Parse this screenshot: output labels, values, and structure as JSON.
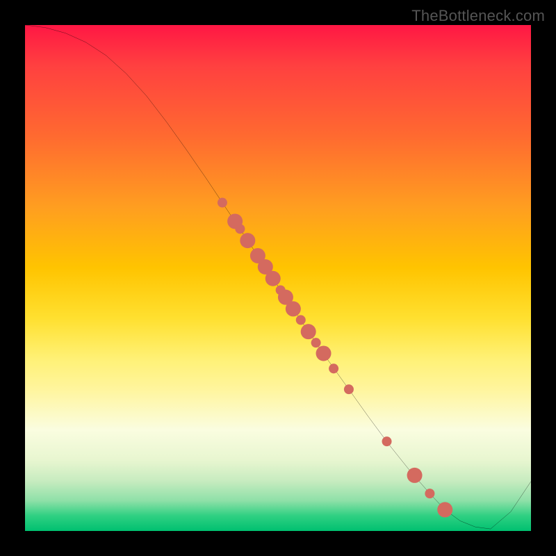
{
  "watermark": "TheBottleneck.com",
  "chart_data": {
    "type": "line",
    "title": "",
    "xlabel": "",
    "ylabel": "",
    "xlim": [
      0,
      100
    ],
    "ylim": [
      0,
      100
    ],
    "grid": false,
    "legend": false,
    "series": [
      {
        "name": "curve",
        "x": [
          0,
          4,
          8,
          12,
          16,
          20,
          24,
          28,
          32,
          36,
          40,
          44,
          48,
          52,
          56,
          60,
          64,
          68,
          72,
          76,
          80,
          83,
          86,
          89,
          92,
          96,
          100
        ],
        "y": [
          100.0,
          99.5,
          98.4,
          96.6,
          94.0,
          90.4,
          86.0,
          80.8,
          75.2,
          69.4,
          63.4,
          57.4,
          51.4,
          45.4,
          39.4,
          33.6,
          28.0,
          22.4,
          17.0,
          12.0,
          7.4,
          4.2,
          2.0,
          0.8,
          0.4,
          3.8,
          9.8
        ],
        "color": "#000000",
        "linewidth": 2.2
      }
    ],
    "markers": [
      {
        "name": "dots",
        "x": [
          39.0,
          41.5,
          42.5,
          44.0,
          46.0,
          47.5,
          49.0,
          50.5,
          51.5,
          53.0,
          54.5,
          56.0,
          57.5,
          59.0,
          61.0,
          64.0,
          71.5,
          77.0,
          80.0,
          83.0
        ],
        "y": [
          64.9,
          61.2,
          59.7,
          57.4,
          54.4,
          52.2,
          49.9,
          47.6,
          46.2,
          43.9,
          41.7,
          39.4,
          37.2,
          35.1,
          32.1,
          28.0,
          17.7,
          11.0,
          7.4,
          4.2
        ],
        "size": [
          7,
          11,
          7,
          11,
          11,
          11,
          11,
          7,
          11,
          11,
          7,
          11,
          7,
          11,
          7,
          7,
          7,
          11,
          7,
          11
        ],
        "color": "#d46a5f"
      }
    ],
    "background_gradient": {
      "direction": "vertical",
      "stops": [
        {
          "pos": 0.0,
          "color": "#ff1744"
        },
        {
          "pos": 0.48,
          "color": "#ffc400"
        },
        {
          "pos": 0.8,
          "color": "#fafde0"
        },
        {
          "pos": 1.0,
          "color": "#00c070"
        }
      ]
    }
  }
}
